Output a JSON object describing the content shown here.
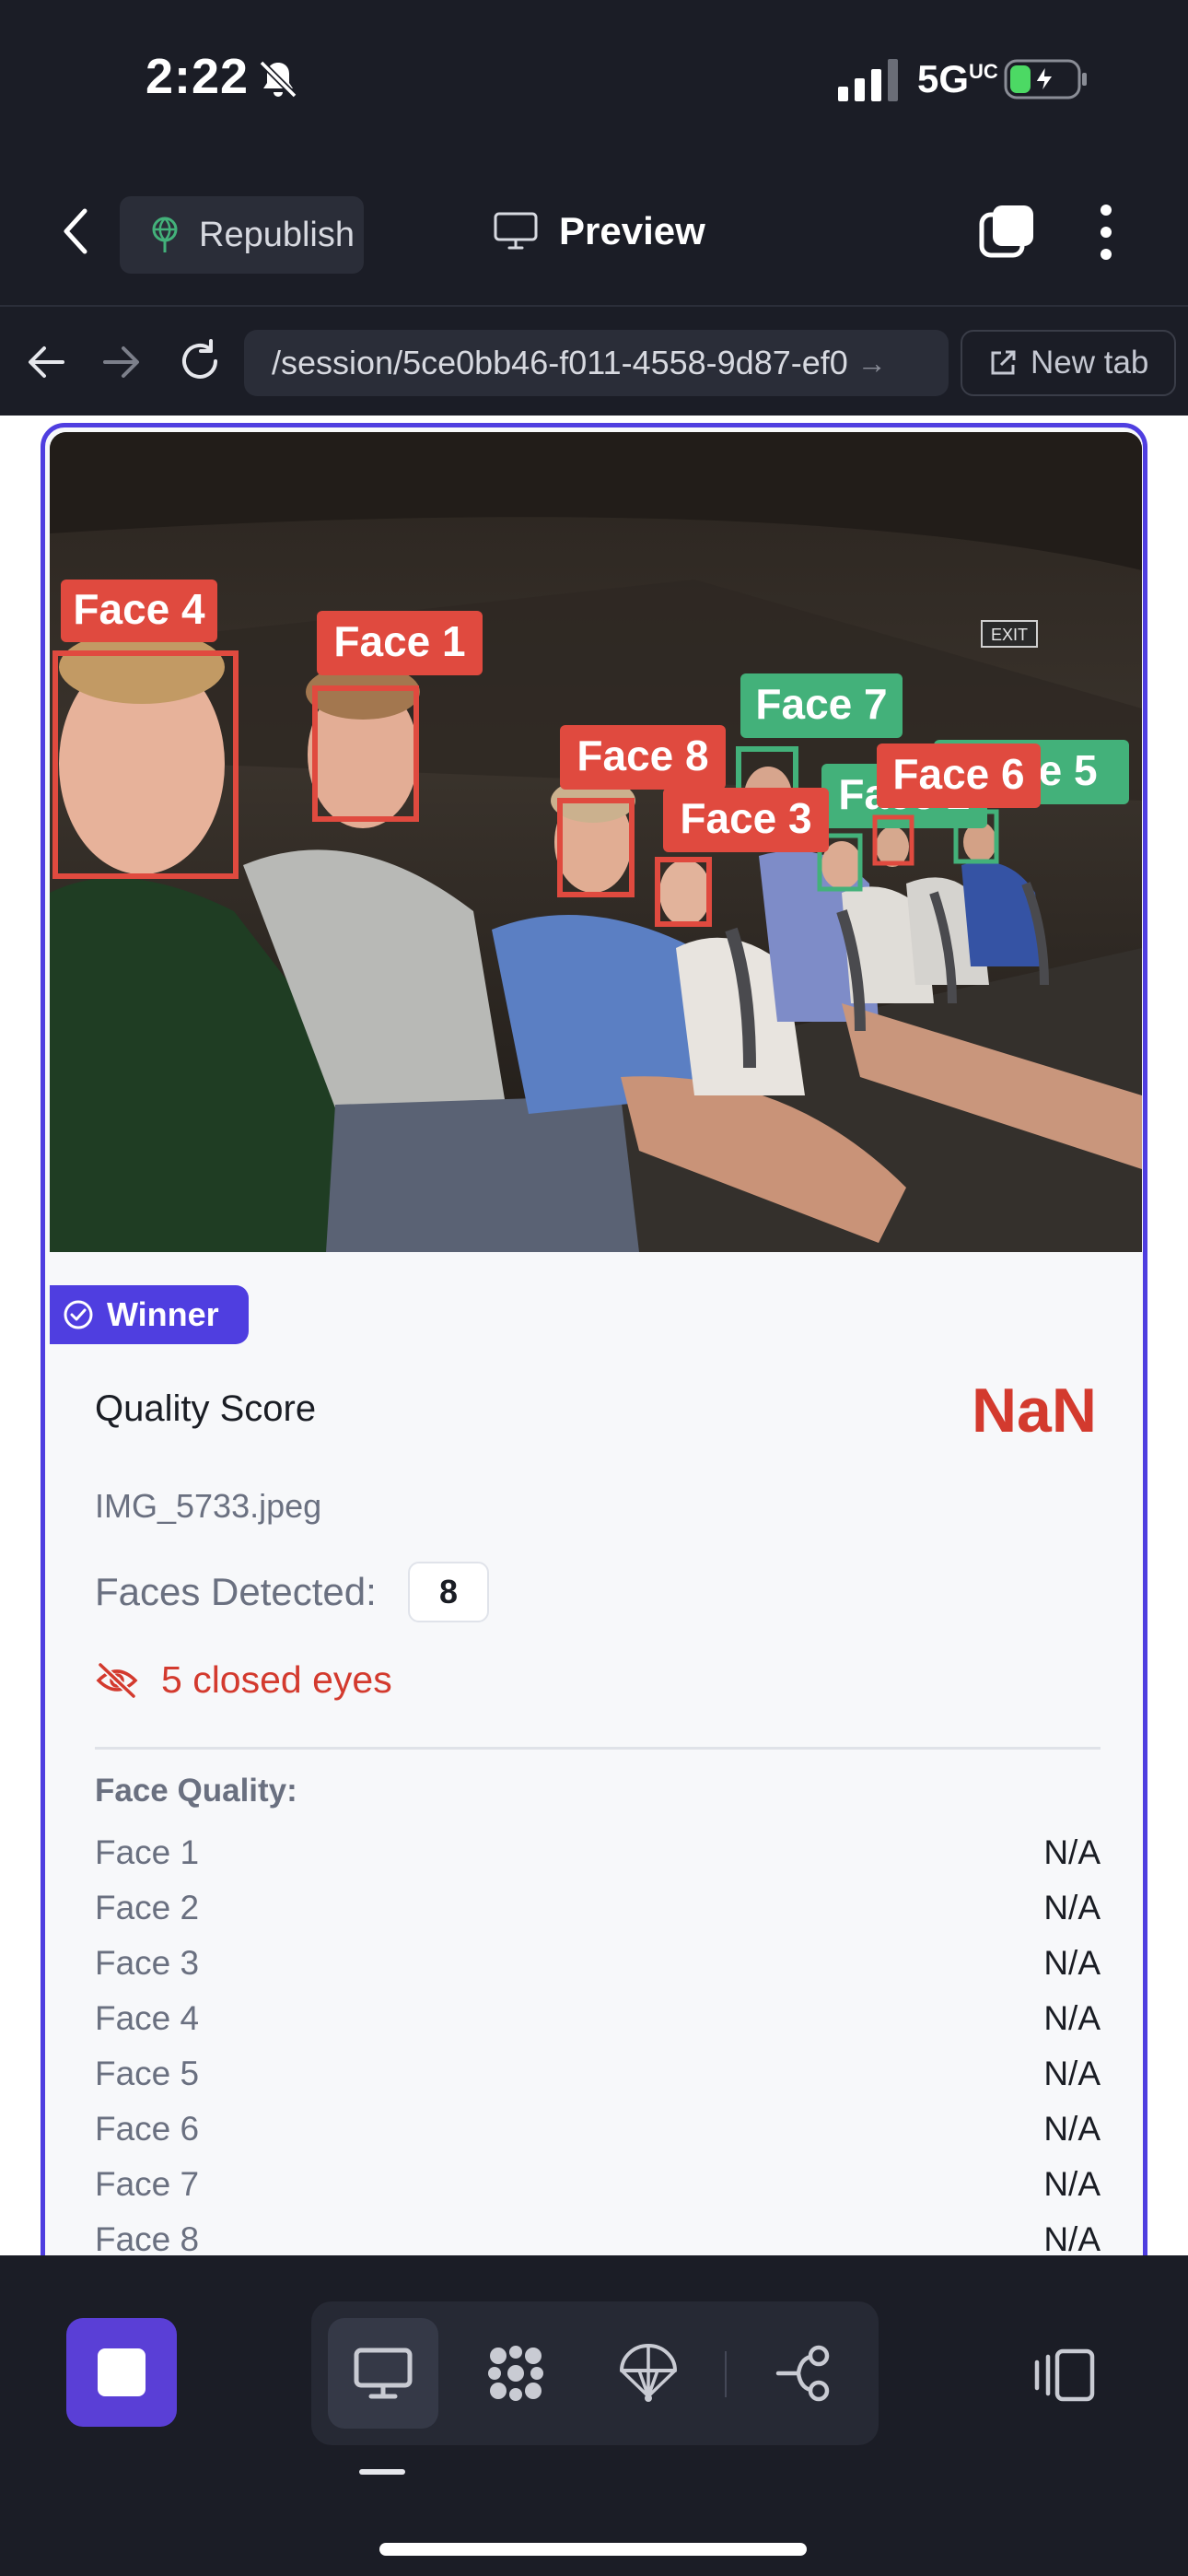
{
  "status_bar": {
    "time": "2:22",
    "network": "5G",
    "network_suffix": "UC"
  },
  "header": {
    "republish_label": "Republish",
    "preview_label": "Preview"
  },
  "browser": {
    "url": "/session/5ce0bb46-f011-4558-9d87-ef0",
    "new_tab_label": "New tab"
  },
  "photo": {
    "face_labels": [
      "Face 4",
      "Face 1",
      "Face 8",
      "Face 3",
      "Face 7",
      "Face 2",
      "Face 6",
      "Face 5"
    ],
    "colors": {
      "open_eyes": "#43b17a",
      "closed_eyes": "#e04a3f"
    }
  },
  "result": {
    "badge_label": "Winner",
    "quality_score_label": "Quality Score",
    "quality_score_value": "NaN",
    "filename": "IMG_5733.jpeg",
    "faces_detected_label": "Faces Detected:",
    "faces_detected_count": "8",
    "closed_eyes_text": "5 closed eyes",
    "face_quality_title": "Face Quality:",
    "face_quality": [
      {
        "name": "Face 1",
        "value": "N/A"
      },
      {
        "name": "Face 2",
        "value": "N/A"
      },
      {
        "name": "Face 3",
        "value": "N/A"
      },
      {
        "name": "Face 4",
        "value": "N/A"
      },
      {
        "name": "Face 5",
        "value": "N/A"
      },
      {
        "name": "Face 6",
        "value": "N/A"
      },
      {
        "name": "Face 7",
        "value": "N/A"
      },
      {
        "name": "Face 8",
        "value": "N/A"
      }
    ]
  },
  "toolbar": {
    "icons": [
      "stop-icon",
      "desktop-icon",
      "grid-icon",
      "parachute-icon",
      "flow-icon",
      "side-panel-icon"
    ],
    "accent": "#5a3fd6"
  }
}
